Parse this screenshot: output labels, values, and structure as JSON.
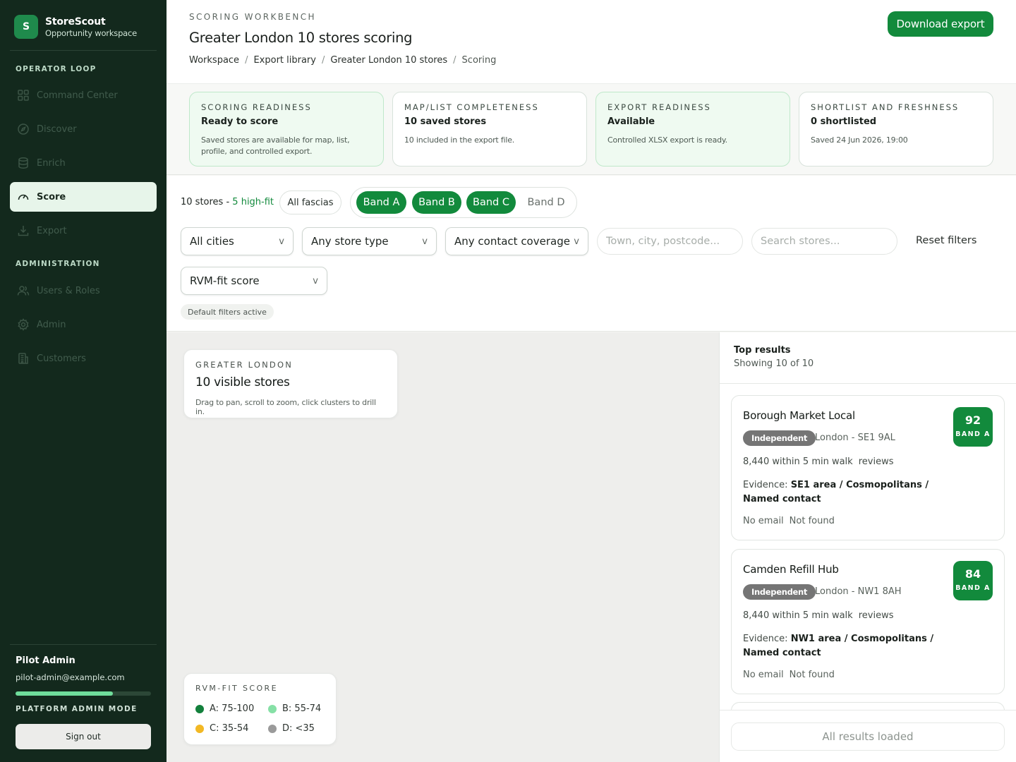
{
  "brand": {
    "logo_letter": "S",
    "name": "StoreScout",
    "subtitle": "Opportunity workspace"
  },
  "sidebar": {
    "sections": [
      {
        "label": "OPERATOR LOOP",
        "items": [
          {
            "label": "Command Center",
            "icon": "grid-icon"
          },
          {
            "label": "Discover",
            "icon": "compass-icon"
          },
          {
            "label": "Enrich",
            "icon": "database-icon"
          },
          {
            "label": "Score",
            "icon": "gauge-icon",
            "active": true
          },
          {
            "label": "Export",
            "icon": "download-icon"
          }
        ]
      },
      {
        "label": "ADMINISTRATION",
        "items": [
          {
            "label": "Users & Roles",
            "icon": "users-icon"
          },
          {
            "label": "Admin",
            "icon": "gear-icon"
          },
          {
            "label": "Customers",
            "icon": "building-icon"
          }
        ]
      }
    ],
    "user": {
      "name": "Pilot Admin",
      "email": "pilot-admin@example.com",
      "progress_pct": 72
    },
    "mode": "PLATFORM ADMIN MODE",
    "sign_out": "Sign out"
  },
  "header": {
    "eyebrow": "SCORING WORKBENCH",
    "title": "Greater London 10 stores scoring",
    "breadcrumb": [
      "Workspace",
      "Export library",
      "Greater London 10 stores",
      "Scoring"
    ],
    "download": "Download export"
  },
  "cards": [
    {
      "key": "SCORING READINESS",
      "title": "Ready to score",
      "desc": "Saved stores are available for map, list, profile, and controlled export.",
      "green": true
    },
    {
      "key": "MAP/LIST COMPLETENESS",
      "title": "10 saved stores",
      "desc": "10 included in the export file.",
      "green": false
    },
    {
      "key": "EXPORT READINESS",
      "title": "Available",
      "desc": "Controlled XLSX export is ready.",
      "green": true
    },
    {
      "key": "SHORTLIST AND FRESHNESS",
      "title": "0 shortlisted",
      "desc": "Saved 24 Jun 2026, 19:00",
      "green": false
    }
  ],
  "filters": {
    "summary_count": "10 stores",
    "summary_sep": " - ",
    "summary_highfit": "5 high-fit",
    "fascias": "All fascias",
    "bands": [
      {
        "label": "Band A",
        "on": true
      },
      {
        "label": "Band B",
        "on": true
      },
      {
        "label": "Band C",
        "on": true
      },
      {
        "label": "Band D",
        "on": false
      }
    ],
    "city": "All cities",
    "store_type": "Any store type",
    "contact": "Any contact coverage",
    "location_placeholder": "Town, city, postcode...",
    "search_placeholder": "Search stores...",
    "reset": "Reset filters",
    "sort": "RVM-fit score",
    "chevron": "v",
    "default_badge": "Default filters active"
  },
  "map": {
    "eyebrow": "GREATER LONDON",
    "title": "10 visible stores",
    "hint": "Drag to pan, scroll to zoom, click clusters to drill in.",
    "legend_title": "RVM-FIT SCORE",
    "legend": [
      {
        "label": "A: 75-100",
        "color": "#13803c"
      },
      {
        "label": "B: 55-74",
        "color": "#86e0a6"
      },
      {
        "label": "C: 35-54",
        "color": "#f2b824"
      },
      {
        "label": "D: <35",
        "color": "#9a9a9a"
      }
    ]
  },
  "results": {
    "title": "Top results",
    "count": "Showing 10 of 10",
    "items": [
      {
        "name": "Borough Market Local",
        "type": "Independent",
        "location": "London - SE1 9AL",
        "walk": "8,440 within 5 min walk",
        "reviews": "reviews",
        "evidence_label": "Evidence:",
        "evidence": "SE1 area / Cosmopolitans / Named contact",
        "email": "No email",
        "contact_status": "Not found",
        "score": "92",
        "band": "BAND A"
      },
      {
        "name": "Camden Refill Hub",
        "type": "Independent",
        "location": "London - NW1 8AH",
        "walk": "8,440 within 5 min walk",
        "reviews": "reviews",
        "evidence_label": "Evidence:",
        "evidence": "NW1 area / Cosmopolitans / Named contact",
        "email": "No email",
        "contact_status": "Not found",
        "score": "84",
        "band": "BAND A"
      }
    ],
    "footer": "All results loaded"
  }
}
